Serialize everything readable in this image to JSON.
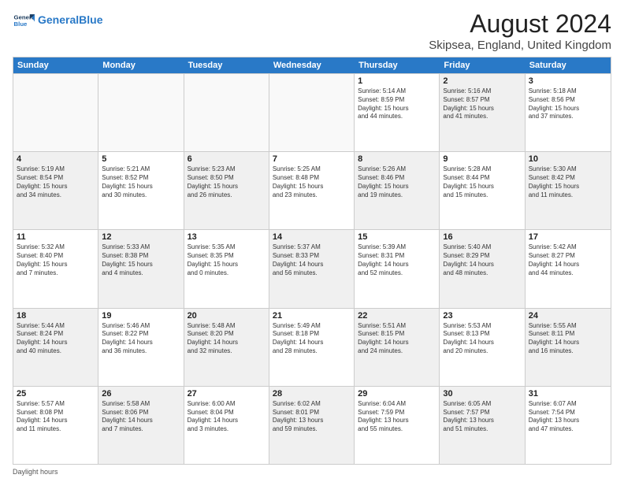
{
  "logo": {
    "line1": "General",
    "line2": "Blue"
  },
  "title": "August 2024",
  "subtitle": "Skipsea, England, United Kingdom",
  "days_of_week": [
    "Sunday",
    "Monday",
    "Tuesday",
    "Wednesday",
    "Thursday",
    "Friday",
    "Saturday"
  ],
  "weeks": [
    [
      {
        "day": "",
        "info": "",
        "shaded": false,
        "empty": true
      },
      {
        "day": "",
        "info": "",
        "shaded": false,
        "empty": true
      },
      {
        "day": "",
        "info": "",
        "shaded": false,
        "empty": true
      },
      {
        "day": "",
        "info": "",
        "shaded": false,
        "empty": true
      },
      {
        "day": "1",
        "info": "Sunrise: 5:14 AM\nSunset: 8:59 PM\nDaylight: 15 hours\nand 44 minutes.",
        "shaded": false,
        "empty": false
      },
      {
        "day": "2",
        "info": "Sunrise: 5:16 AM\nSunset: 8:57 PM\nDaylight: 15 hours\nand 41 minutes.",
        "shaded": true,
        "empty": false
      },
      {
        "day": "3",
        "info": "Sunrise: 5:18 AM\nSunset: 8:56 PM\nDaylight: 15 hours\nand 37 minutes.",
        "shaded": false,
        "empty": false
      }
    ],
    [
      {
        "day": "4",
        "info": "Sunrise: 5:19 AM\nSunset: 8:54 PM\nDaylight: 15 hours\nand 34 minutes.",
        "shaded": true,
        "empty": false
      },
      {
        "day": "5",
        "info": "Sunrise: 5:21 AM\nSunset: 8:52 PM\nDaylight: 15 hours\nand 30 minutes.",
        "shaded": false,
        "empty": false
      },
      {
        "day": "6",
        "info": "Sunrise: 5:23 AM\nSunset: 8:50 PM\nDaylight: 15 hours\nand 26 minutes.",
        "shaded": true,
        "empty": false
      },
      {
        "day": "7",
        "info": "Sunrise: 5:25 AM\nSunset: 8:48 PM\nDaylight: 15 hours\nand 23 minutes.",
        "shaded": false,
        "empty": false
      },
      {
        "day": "8",
        "info": "Sunrise: 5:26 AM\nSunset: 8:46 PM\nDaylight: 15 hours\nand 19 minutes.",
        "shaded": true,
        "empty": false
      },
      {
        "day": "9",
        "info": "Sunrise: 5:28 AM\nSunset: 8:44 PM\nDaylight: 15 hours\nand 15 minutes.",
        "shaded": false,
        "empty": false
      },
      {
        "day": "10",
        "info": "Sunrise: 5:30 AM\nSunset: 8:42 PM\nDaylight: 15 hours\nand 11 minutes.",
        "shaded": true,
        "empty": false
      }
    ],
    [
      {
        "day": "11",
        "info": "Sunrise: 5:32 AM\nSunset: 8:40 PM\nDaylight: 15 hours\nand 7 minutes.",
        "shaded": false,
        "empty": false
      },
      {
        "day": "12",
        "info": "Sunrise: 5:33 AM\nSunset: 8:38 PM\nDaylight: 15 hours\nand 4 minutes.",
        "shaded": true,
        "empty": false
      },
      {
        "day": "13",
        "info": "Sunrise: 5:35 AM\nSunset: 8:35 PM\nDaylight: 15 hours\nand 0 minutes.",
        "shaded": false,
        "empty": false
      },
      {
        "day": "14",
        "info": "Sunrise: 5:37 AM\nSunset: 8:33 PM\nDaylight: 14 hours\nand 56 minutes.",
        "shaded": true,
        "empty": false
      },
      {
        "day": "15",
        "info": "Sunrise: 5:39 AM\nSunset: 8:31 PM\nDaylight: 14 hours\nand 52 minutes.",
        "shaded": false,
        "empty": false
      },
      {
        "day": "16",
        "info": "Sunrise: 5:40 AM\nSunset: 8:29 PM\nDaylight: 14 hours\nand 48 minutes.",
        "shaded": true,
        "empty": false
      },
      {
        "day": "17",
        "info": "Sunrise: 5:42 AM\nSunset: 8:27 PM\nDaylight: 14 hours\nand 44 minutes.",
        "shaded": false,
        "empty": false
      }
    ],
    [
      {
        "day": "18",
        "info": "Sunrise: 5:44 AM\nSunset: 8:24 PM\nDaylight: 14 hours\nand 40 minutes.",
        "shaded": true,
        "empty": false
      },
      {
        "day": "19",
        "info": "Sunrise: 5:46 AM\nSunset: 8:22 PM\nDaylight: 14 hours\nand 36 minutes.",
        "shaded": false,
        "empty": false
      },
      {
        "day": "20",
        "info": "Sunrise: 5:48 AM\nSunset: 8:20 PM\nDaylight: 14 hours\nand 32 minutes.",
        "shaded": true,
        "empty": false
      },
      {
        "day": "21",
        "info": "Sunrise: 5:49 AM\nSunset: 8:18 PM\nDaylight: 14 hours\nand 28 minutes.",
        "shaded": false,
        "empty": false
      },
      {
        "day": "22",
        "info": "Sunrise: 5:51 AM\nSunset: 8:15 PM\nDaylight: 14 hours\nand 24 minutes.",
        "shaded": true,
        "empty": false
      },
      {
        "day": "23",
        "info": "Sunrise: 5:53 AM\nSunset: 8:13 PM\nDaylight: 14 hours\nand 20 minutes.",
        "shaded": false,
        "empty": false
      },
      {
        "day": "24",
        "info": "Sunrise: 5:55 AM\nSunset: 8:11 PM\nDaylight: 14 hours\nand 16 minutes.",
        "shaded": true,
        "empty": false
      }
    ],
    [
      {
        "day": "25",
        "info": "Sunrise: 5:57 AM\nSunset: 8:08 PM\nDaylight: 14 hours\nand 11 minutes.",
        "shaded": false,
        "empty": false
      },
      {
        "day": "26",
        "info": "Sunrise: 5:58 AM\nSunset: 8:06 PM\nDaylight: 14 hours\nand 7 minutes.",
        "shaded": true,
        "empty": false
      },
      {
        "day": "27",
        "info": "Sunrise: 6:00 AM\nSunset: 8:04 PM\nDaylight: 14 hours\nand 3 minutes.",
        "shaded": false,
        "empty": false
      },
      {
        "day": "28",
        "info": "Sunrise: 6:02 AM\nSunset: 8:01 PM\nDaylight: 13 hours\nand 59 minutes.",
        "shaded": true,
        "empty": false
      },
      {
        "day": "29",
        "info": "Sunrise: 6:04 AM\nSunset: 7:59 PM\nDaylight: 13 hours\nand 55 minutes.",
        "shaded": false,
        "empty": false
      },
      {
        "day": "30",
        "info": "Sunrise: 6:05 AM\nSunset: 7:57 PM\nDaylight: 13 hours\nand 51 minutes.",
        "shaded": true,
        "empty": false
      },
      {
        "day": "31",
        "info": "Sunrise: 6:07 AM\nSunset: 7:54 PM\nDaylight: 13 hours\nand 47 minutes.",
        "shaded": false,
        "empty": false
      }
    ]
  ],
  "footer": "Daylight hours"
}
